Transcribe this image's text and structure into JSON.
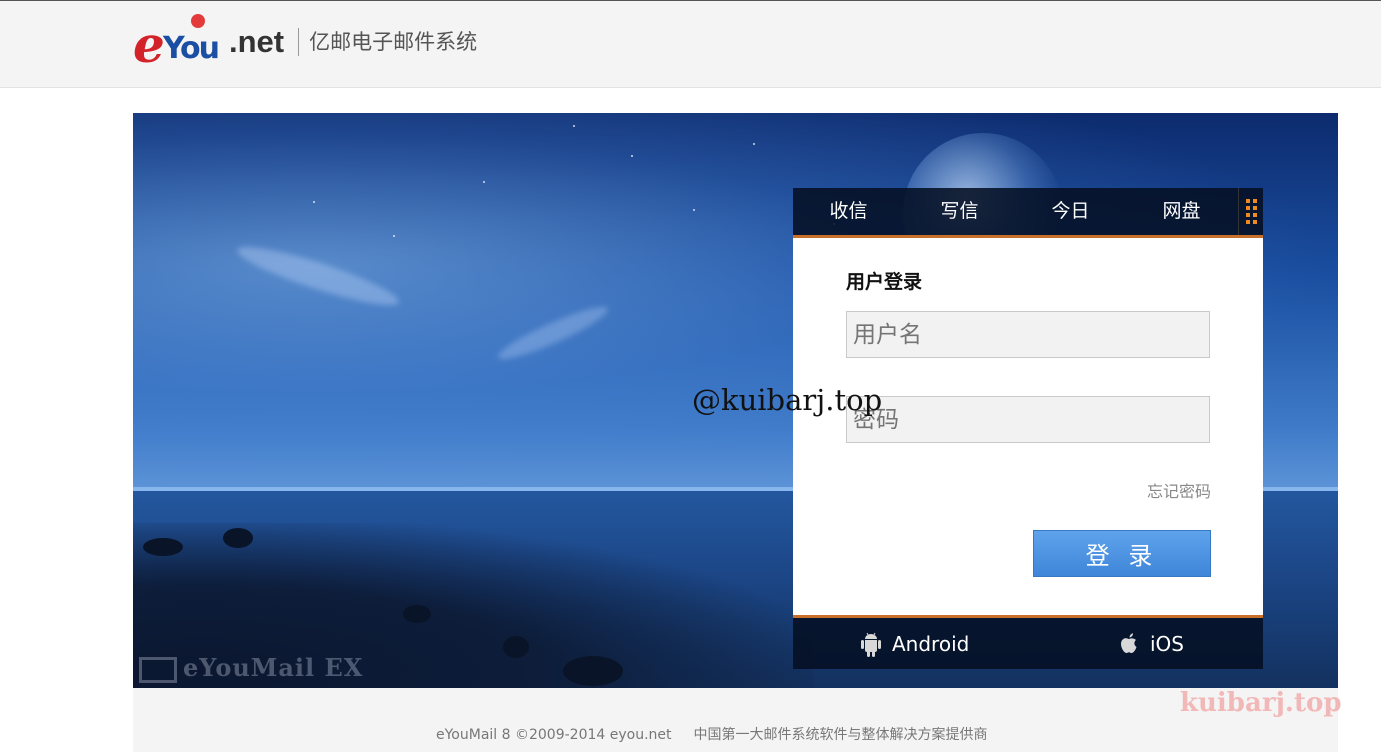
{
  "header": {
    "logo": {
      "e": "e",
      "you": "You",
      "net": ".net"
    },
    "subtitle": "亿邮电子邮件系统"
  },
  "hero": {
    "brand_watermark": "eYouMail EX"
  },
  "nav_tabs": [
    {
      "label": "收信"
    },
    {
      "label": "写信"
    },
    {
      "label": "今日"
    },
    {
      "label": "网盘"
    }
  ],
  "login": {
    "title": "用户登录",
    "username_placeholder": "用户名",
    "password_placeholder": "密码",
    "forgot_label": "忘记密码",
    "submit_label": "登 录"
  },
  "apps": {
    "android_label": "Android",
    "ios_label": "iOS"
  },
  "overlay_watermark": "@kuibarj.top",
  "corner_watermark": "kuibarj.top",
  "footer": {
    "copyright": "eYouMail 8 ©2009-2014 eyou.net",
    "tagline": "中国第一大邮件系统软件与整体解决方案提供商"
  },
  "colors": {
    "tab_bar": "#050f23",
    "accent_orange": "#c8702a",
    "button_blue": "#4a90e0"
  }
}
